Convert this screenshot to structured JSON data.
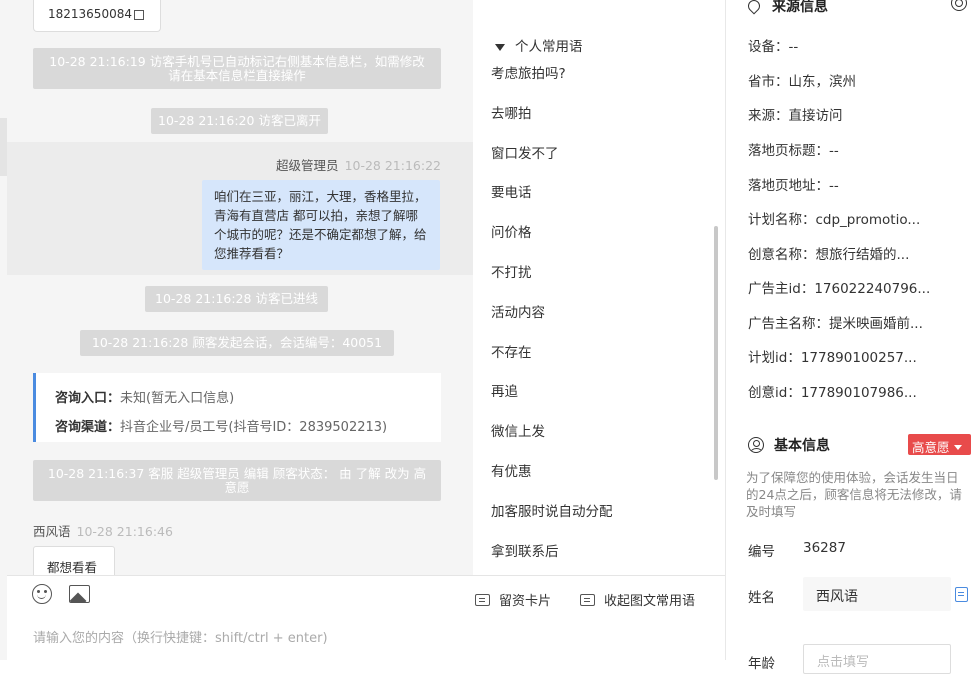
{
  "chat": {
    "phone": "18213650084",
    "sys_msgs": [
      "10-28 21:16:19 访客手机号已自动标记右侧基本信息栏，如需修改请在基本信息栏直接操作",
      "10-28 21:16:20 访客已离开",
      "10-28 21:16:28 访客已进线",
      "10-28 21:16:28 顾客发起会话，会话编号：40051",
      "10-28 21:16:37 客服 超级管理员 编辑 顾客状态： 由 了解 改为 高意愿"
    ],
    "agent": {
      "name": "超级管理员",
      "time": "10-28 21:16:22",
      "message": "咱们在三亚，丽江，大理，香格里拉，青海有直营店 都可以拍，亲想了解哪个城市的呢？还是不确定都想了解，给您推荐看看？"
    },
    "entry": {
      "label1": "咨询入口：",
      "value1": "未知(暂无入口信息)",
      "label2": "咨询渠道：",
      "value2": "抖音企业号/员工号(抖音号ID：2839502213)"
    },
    "customer": {
      "name": "西风语",
      "time": "10-28 21:16:46",
      "message": "都想看看"
    }
  },
  "phrases": {
    "header": "个人常用语",
    "items": [
      "考虑旅拍吗?",
      "去哪拍",
      "窗口发不了",
      "要电话",
      "问价格",
      "不打扰",
      "活动内容",
      "不存在",
      "再追",
      "微信上发",
      "有优惠",
      "加客服时说自动分配",
      "拿到联系后"
    ]
  },
  "toolbar": {
    "card_label": "留资卡片",
    "collapse_label": "收起图文常用语",
    "input_placeholder": "请输入您的内容（换行快捷键：shift/ctrl + enter)"
  },
  "source_info": {
    "title": "来源信息",
    "rows": [
      "设备：--",
      "省市：山东，滨州",
      "来源：直接访问",
      "落地页标题：--",
      "落地页地址：--",
      "计划名称：cdp_promotio...",
      "创意名称：想旅行结婚的...",
      "广告主id：176022240796...",
      "广告主名称：提米映画婚前...",
      "计划id：177890100257...",
      "创意id：177890107986..."
    ]
  },
  "basic_info": {
    "title": "基本信息",
    "status_badge": "高意愿",
    "notice": "为了保障您的使用体验，会话发生当日的24点之后，顾客信息将无法修改，请及时填写",
    "id_label": "编号",
    "id_value": "36287",
    "name_label": "姓名",
    "name_value": "西风语",
    "age_label": "年龄",
    "age_placeholder": "点击填写"
  }
}
